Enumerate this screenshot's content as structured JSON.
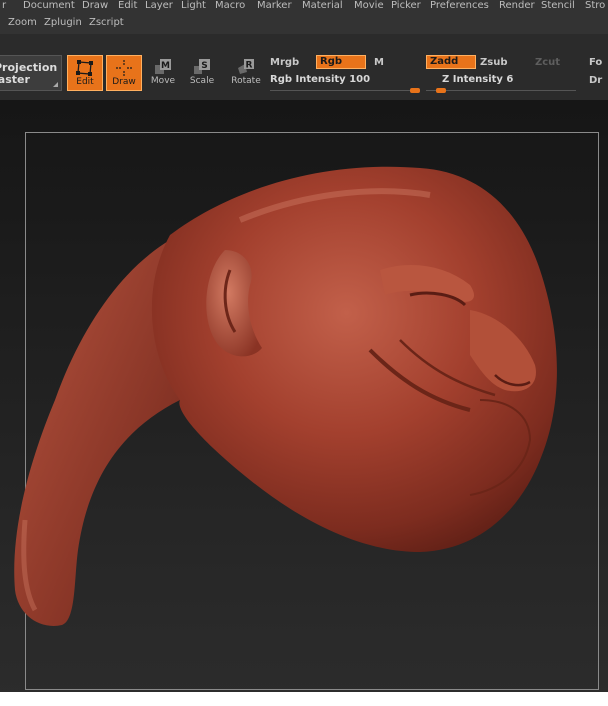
{
  "menu": {
    "row1": [
      "r",
      "Document",
      "Draw",
      "Edit",
      "Layer",
      "Light",
      "Macro",
      "Marker",
      "Material",
      "Movie",
      "Picker",
      "Preferences",
      "Render",
      "Stencil",
      "Stro"
    ],
    "row2": [
      "Zoom",
      "Zplugin",
      "Zscript"
    ]
  },
  "toolbar": {
    "projection": {
      "line1": "Projection",
      "line2": "laster"
    },
    "tools": [
      {
        "label": "Edit",
        "icon": "edit-icon",
        "active": true
      },
      {
        "label": "Draw",
        "icon": "draw-icon",
        "active": true
      },
      {
        "label": "Move",
        "icon": "move-icon",
        "key": "M",
        "active": false
      },
      {
        "label": "Scale",
        "icon": "scale-icon",
        "key": "S",
        "active": false
      },
      {
        "label": "Rotate",
        "icon": "rotate-icon",
        "key": "R",
        "active": false
      }
    ],
    "mrgb": "Mrgb",
    "rgb": "Rgb",
    "m": "M",
    "rgb_intensity_label": "Rgb  Intensity",
    "rgb_intensity_value": "100",
    "zadd": "Zadd",
    "zsub": "Zsub",
    "zcut": "Zcut",
    "z_intensity_label": "Z  Intensity",
    "z_intensity_value": "6",
    "right_top": "Fo",
    "right_bottom": "Dr"
  },
  "colors": {
    "accent": "#e8731a",
    "clay": "#a0402e",
    "background": "#1f1f1f"
  }
}
